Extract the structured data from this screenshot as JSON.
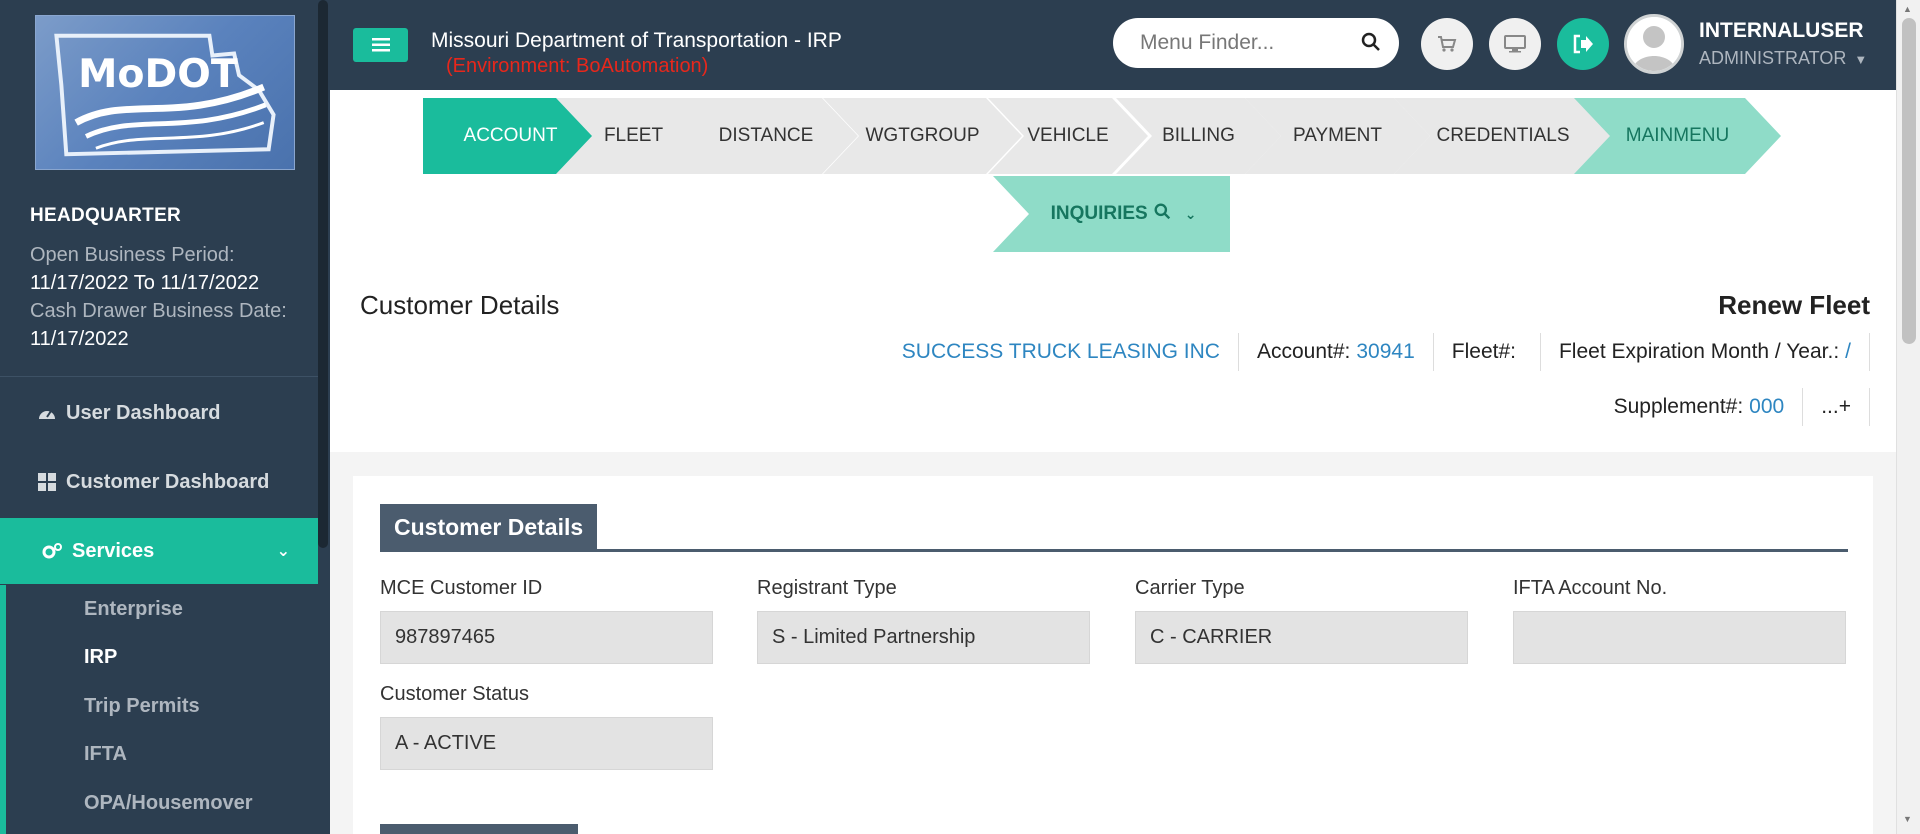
{
  "sidebar": {
    "logo_text": "MoDOT",
    "office": "HEADQUARTER",
    "open_period_label": "Open Business Period:",
    "open_period_value": "11/17/2022 To 11/17/2022",
    "cash_drawer_label": "Cash Drawer Business Date:",
    "cash_drawer_value": "11/17/2022",
    "nav": [
      {
        "label": "User Dashboard",
        "icon": "dashboard-icon"
      },
      {
        "label": "Customer Dashboard",
        "icon": "grid-icon"
      },
      {
        "label": "Services",
        "icon": "gears-icon"
      }
    ],
    "submenu": [
      "Enterprise",
      "IRP",
      "Trip Permits",
      "IFTA",
      "OPA/Housemover"
    ]
  },
  "topbar": {
    "title": "Missouri Department of Transportation - IRP",
    "environment": "(Environment: BoAutomation)",
    "menu_finder_placeholder": "Menu Finder...",
    "username": "INTERNALUSER",
    "role": "ADMINISTRATOR"
  },
  "steps": [
    "ACCOUNT",
    "FLEET",
    "DISTANCE",
    "WGTGROUP",
    "VEHICLE",
    "BILLING",
    "PAYMENT",
    "CREDENTIALS",
    "MAINMENU"
  ],
  "inquiries_label": "INQUIRIES",
  "header": {
    "title": "Customer Details",
    "renew_title": "Renew Fleet",
    "company": "SUCCESS TRUCK LEASING INC",
    "account_label": "Account#:",
    "account_value": "30941",
    "fleet_label": "Fleet#:",
    "fleet_value": "",
    "fleet_exp_label": "Fleet Expiration Month / Year.:",
    "fleet_exp_value": "/",
    "supplement_label": "Supplement#:",
    "supplement_value": "000",
    "more_link": "...+"
  },
  "section": {
    "title": "Customer Details",
    "fields": [
      {
        "label": "MCE Customer ID",
        "value": "987897465"
      },
      {
        "label": "Registrant Type",
        "value": "S - Limited Partnership"
      },
      {
        "label": "Carrier Type",
        "value": "C - CARRIER"
      },
      {
        "label": "IFTA Account No.",
        "value": ""
      },
      {
        "label": "Customer Status",
        "value": "A - ACTIVE"
      }
    ]
  },
  "colors": {
    "sidebar_bg": "#2c3e50",
    "accent": "#1abc9c",
    "step_light": "#8fdcc8",
    "link": "#2e86c1",
    "env_red": "#e8271b"
  }
}
